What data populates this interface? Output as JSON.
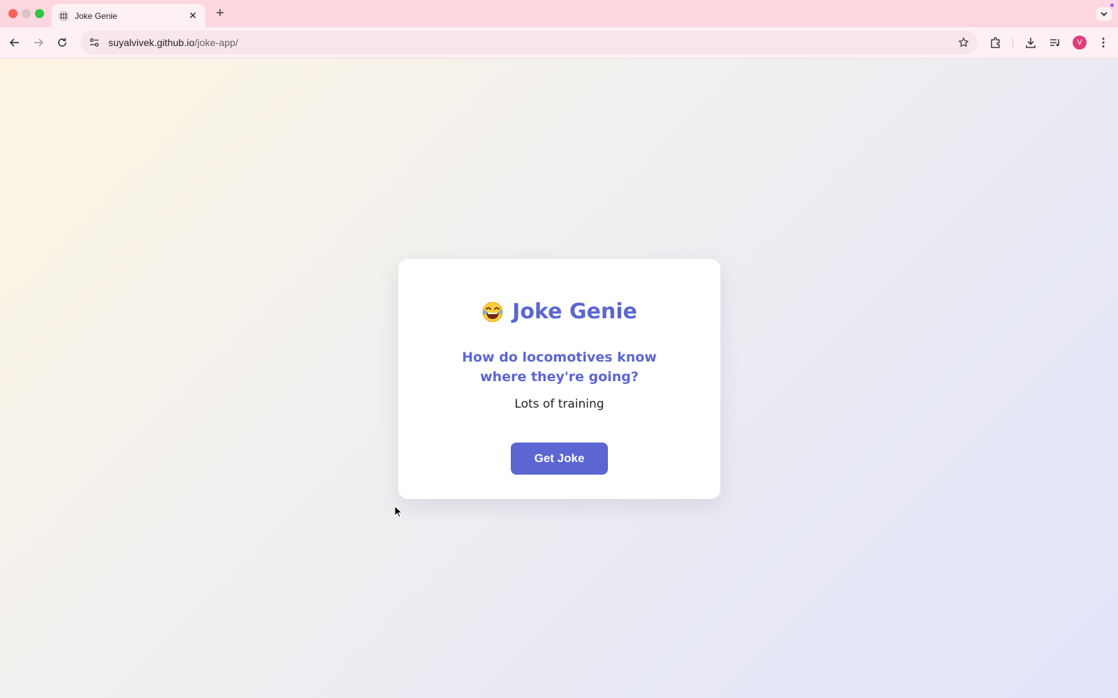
{
  "browser": {
    "tab": {
      "title": "Joke Genie",
      "favicon": "globe-icon"
    },
    "address_bar": {
      "host": "suyalvivek.github.io",
      "path": "/joke-app/"
    },
    "profile_initial": "V"
  },
  "page": {
    "emoji": "face-with-tears-of-joy",
    "title": "Joke Genie",
    "joke_setup": "How do locomotives know where they're going?",
    "joke_punchline": "Lots of training",
    "button_label": "Get Joke"
  },
  "colors": {
    "accent": "#5b66d2",
    "tabstrip": "#fdd6df",
    "avatar": "#e03d7c"
  }
}
